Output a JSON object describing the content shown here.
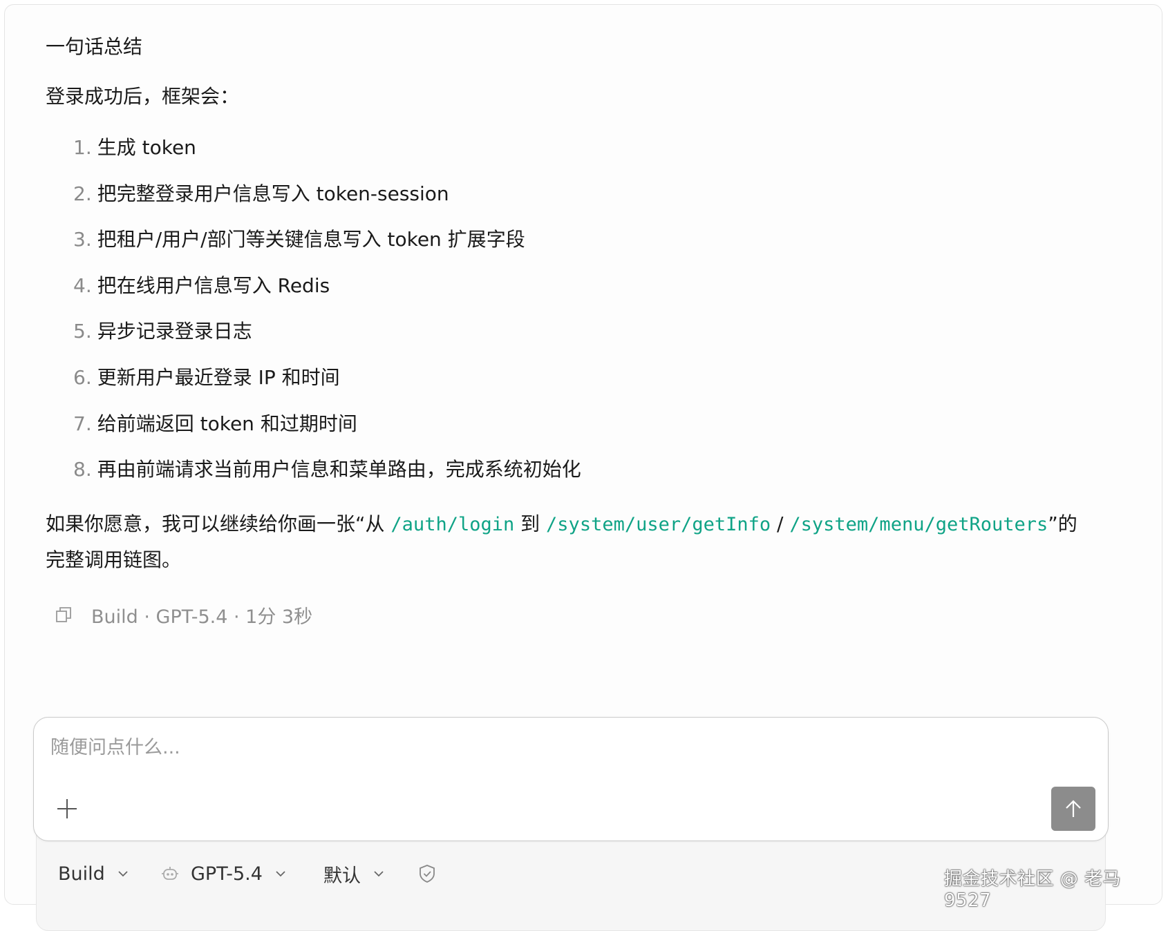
{
  "message": {
    "heading": "一句话总结",
    "intro": "登录成功后，框架会：",
    "steps": [
      {
        "num": "1.",
        "text": "生成 token"
      },
      {
        "num": "2.",
        "text": "把完整登录用户信息写入 token-session"
      },
      {
        "num": "3.",
        "text": "把租户/用户/部门等关键信息写入 token 扩展字段"
      },
      {
        "num": "4.",
        "text": "把在线用户信息写入 Redis"
      },
      {
        "num": "5.",
        "text": "异步记录登录日志"
      },
      {
        "num": "6.",
        "text": "更新用户最近登录 IP 和时间"
      },
      {
        "num": "7.",
        "text": "给前端返回 token 和过期时间"
      },
      {
        "num": "8.",
        "text": "再由前端请求当前用户信息和菜单路由，完成系统初始化"
      }
    ],
    "closing": {
      "part1": "如果你愿意，我可以继续给你画一张“从 ",
      "code1": "/auth/login",
      "part2": " 到 ",
      "code2": "/system/user/getInfo",
      "part3": " / ",
      "code3": "/system/menu/getRouters",
      "part4": "”的完整调用链图。"
    },
    "meta": "Build · GPT-5.4 · 1分 3秒"
  },
  "composer": {
    "placeholder": "随便问点什么...",
    "value": ""
  },
  "toolbar": {
    "mode_label": "Build",
    "model_label": "GPT-5.4",
    "preset_label": "默认"
  },
  "watermark": "掘金技术社区 @ 老马9527",
  "colors": {
    "code": "#0fa386",
    "send_button": "#8c8c8c",
    "muted_text": "#8f8f8f"
  },
  "icons": [
    "copy-icon",
    "plus-icon",
    "arrow-up-icon",
    "chevron-down-icon",
    "robot-icon",
    "shield-check-icon"
  ]
}
